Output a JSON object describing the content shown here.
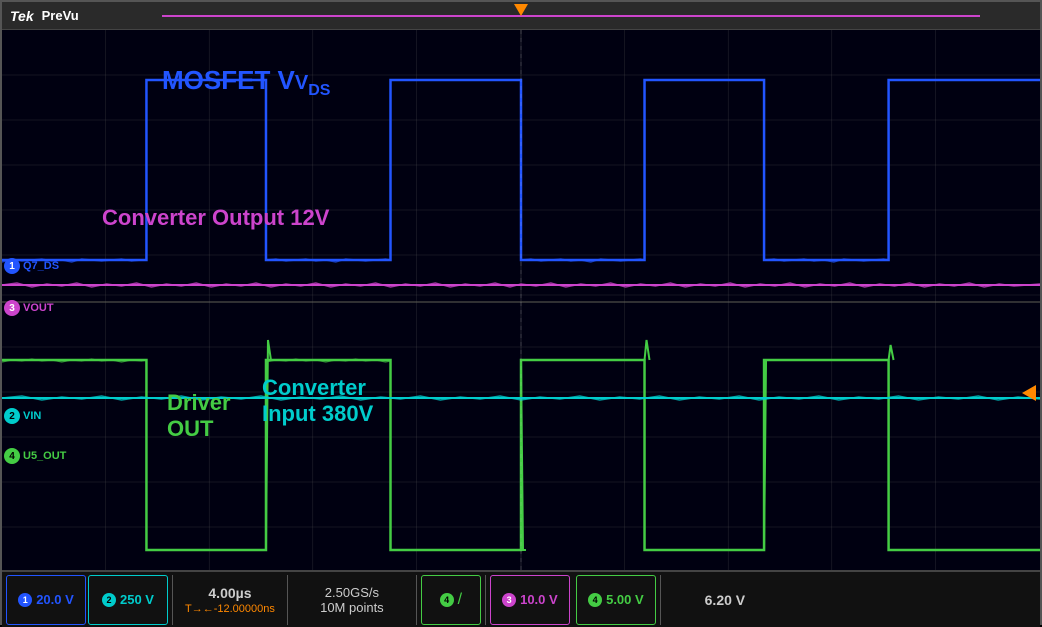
{
  "header": {
    "brand": "Tek",
    "mode": "PreVu"
  },
  "channels": {
    "ch1": {
      "label": "1",
      "color": "#2255ff",
      "probe": "Q7_DS",
      "scale": "20.0 V"
    },
    "ch2": {
      "label": "2",
      "color": "#00cccc",
      "probe": "VIN",
      "scale": "250 V"
    },
    "ch3": {
      "label": "3",
      "color": "#cc44cc",
      "probe": "VOUT",
      "scale": "10.0 V"
    },
    "ch4": {
      "label": "4",
      "color": "#44cc44",
      "probe": "U5_OUT",
      "scale": "5.00 V"
    }
  },
  "signal_labels": {
    "mosfet": "MOSFET V",
    "mosfet_sub": "DS",
    "converter_output": "Converter Output 12V",
    "converter_input": "Converter\nInput 380V",
    "driver_out": "Driver\nOUT"
  },
  "timebase": {
    "time_div": "4.00µs",
    "sample_rate": "2.50GS/s",
    "record": "10M points",
    "trigger_offset": "T→←-12.00000ns"
  },
  "ch4_indicator": {
    "symbol": "/"
  },
  "bottom_right": {
    "value": "6.20 V"
  },
  "colors": {
    "ch1": "#2255ff",
    "ch2": "#00cccc",
    "ch3": "#cc44cc",
    "ch4": "#44cc44",
    "trigger": "#ff8800",
    "grid": "rgba(100,100,100,0.4)"
  }
}
